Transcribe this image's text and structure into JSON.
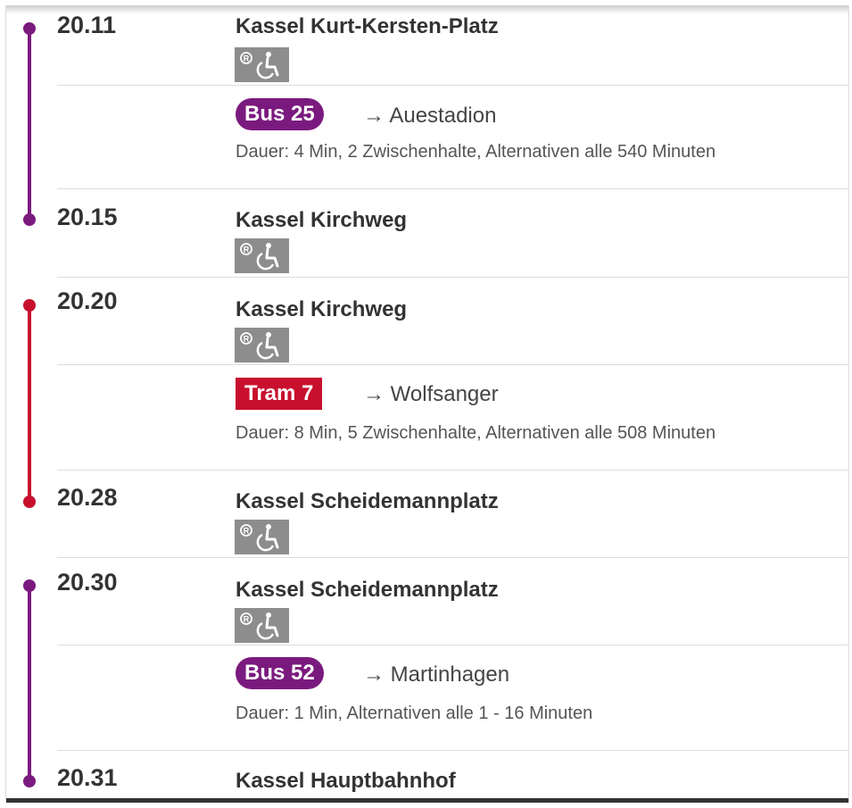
{
  "colors": {
    "bus": "#7b1a7e",
    "tram": "#c8102e",
    "text": "#333333",
    "divider": "#dcdcdc",
    "icon_bg": "#8d8d8d"
  },
  "icons": {
    "accessibility": "wheelchair-icon",
    "reserved": "r-circle-icon"
  },
  "legs": [
    {
      "mode": "bus",
      "line": "Bus 25",
      "direction": "→ Auestadion",
      "duration": "Dauer: 4 Min, 2 Zwischenhalte, Alternativen alle 540 Minuten",
      "departure": {
        "time": "20.11",
        "station": "Kassel Kurt-Kersten-Platz"
      },
      "arrival": {
        "time": "20.15",
        "station": "Kassel Kirchweg"
      }
    },
    {
      "mode": "tram",
      "line": "Tram 7",
      "direction": "→ Wolfsanger",
      "duration": "Dauer: 8 Min, 5 Zwischenhalte, Alternativen alle 508 Minuten",
      "departure": {
        "time": "20.20",
        "station": "Kassel Kirchweg"
      },
      "arrival": {
        "time": "20.28",
        "station": "Kassel Scheidemannplatz"
      }
    },
    {
      "mode": "bus",
      "line": "Bus 52",
      "direction": "→ Martinhagen",
      "duration": "Dauer: 1 Min, Alternativen alle 1 - 16 Minuten",
      "departure": {
        "time": "20.30",
        "station": "Kassel Scheidemannplatz"
      },
      "arrival": {
        "time": "20.31",
        "station": "Kassel Hauptbahnhof"
      }
    }
  ]
}
